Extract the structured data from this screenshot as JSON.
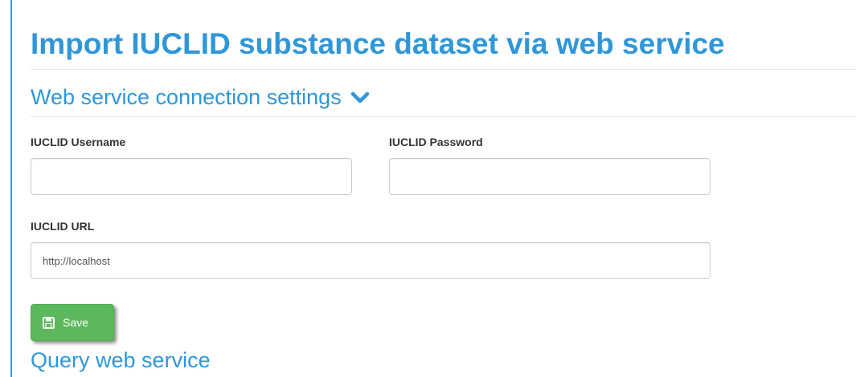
{
  "page": {
    "title": "Import IUCLID substance dataset via web service"
  },
  "connection_settings": {
    "heading": "Web service connection settings",
    "toggle_icon": "chevron-down-icon",
    "username": {
      "label": "IUCLID Username",
      "value": "",
      "placeholder": ""
    },
    "password": {
      "label": "IUCLID Password",
      "value": "",
      "placeholder": ""
    },
    "url": {
      "label": "IUCLID URL",
      "value": "http://localhost",
      "placeholder": ""
    },
    "save_button": {
      "label": "Save",
      "icon": "floppy-disk-icon"
    }
  },
  "query": {
    "heading": "Query web service"
  },
  "colors": {
    "heading": "#2f97d8",
    "save_button": "#5cb85c",
    "accent_rule": "#3a9bdc"
  }
}
